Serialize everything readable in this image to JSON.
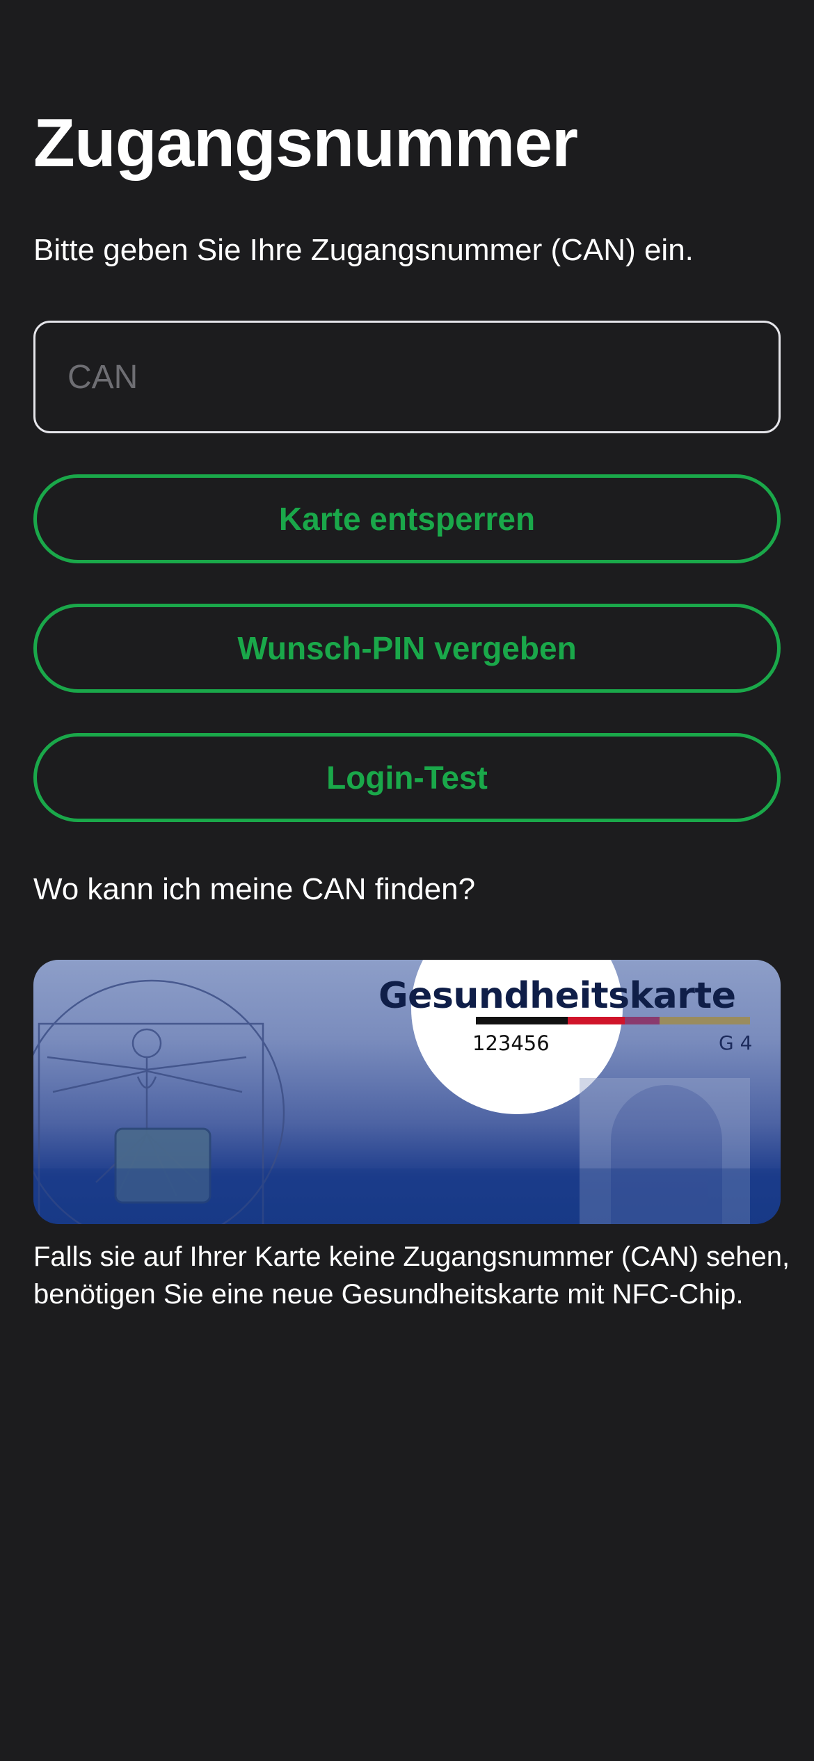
{
  "page": {
    "title": "Zugangsnummer",
    "subtitle": "Bitte geben Sie Ihre Zugangsnummer (CAN) ein."
  },
  "can_field": {
    "value": "",
    "placeholder": "CAN"
  },
  "buttons": {
    "unlock_label": "Karte entsperren",
    "pin_label": "Wunsch-PIN vergeben",
    "login_label": "Login-Test"
  },
  "help": {
    "question": "Wo kann ich meine CAN finden?",
    "info": "Falls sie auf Ihrer Karte keine Zugangsnummer (CAN) sehen, benötigen Sie eine neue Gesundheitskarte mit NFC-Chip."
  },
  "card_image": {
    "title": "Gesundheitskarte",
    "can_number": "123456",
    "generation": "G 4"
  },
  "colors": {
    "background": "#1c1c1e",
    "accent": "#1aa84a",
    "text": "#ffffff",
    "placeholder": "#6e6e73"
  }
}
